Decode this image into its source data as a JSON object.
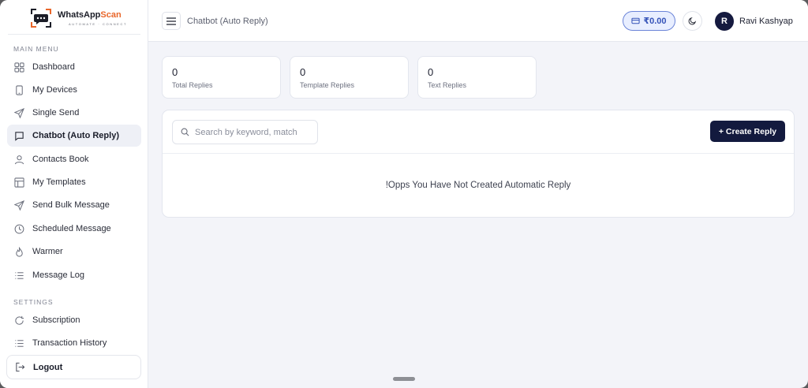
{
  "brand": {
    "name_primary": "WhatsApp",
    "name_accent": "Scan",
    "tagline": "AUTOMATE · CONNECT"
  },
  "sidebar": {
    "main_menu_label": "MAIN MENU",
    "settings_label": "SETTINGS",
    "items": [
      {
        "label": "Dashboard",
        "icon": "grid-icon"
      },
      {
        "label": "My Devices",
        "icon": "phone-icon"
      },
      {
        "label": "Single Send",
        "icon": "send-icon"
      },
      {
        "label": "Chatbot (Auto Reply)",
        "icon": "chat-icon",
        "active": true
      },
      {
        "label": "Contacts Book",
        "icon": "user-icon"
      },
      {
        "label": "My Templates",
        "icon": "layout-icon"
      },
      {
        "label": "Send Bulk Message",
        "icon": "send-icon"
      },
      {
        "label": "Scheduled Message",
        "icon": "clock-icon"
      },
      {
        "label": "Warmer",
        "icon": "flame-icon"
      },
      {
        "label": "Message Log",
        "icon": "list-icon"
      }
    ],
    "settings_items": [
      {
        "label": "Subscription",
        "icon": "refresh-icon"
      },
      {
        "label": "Transaction History",
        "icon": "list-icon"
      }
    ],
    "logout_label": "Logout"
  },
  "header": {
    "title": "Chatbot (Auto Reply)",
    "wallet_amount": "₹0.00",
    "avatar_initial": "R",
    "user_name": "Ravi Kashyap"
  },
  "stats": [
    {
      "value": "0",
      "label": "Total Replies"
    },
    {
      "value": "0",
      "label": "Template Replies"
    },
    {
      "value": "0",
      "label": "Text Replies"
    }
  ],
  "panel": {
    "search_placeholder": "Search by keyword, match",
    "create_button": "+ Create Reply",
    "empty_message": "!Opps You Have Not Created Automatic Reply"
  },
  "colors": {
    "accent": "#131a3e",
    "brand_orange": "#e8662a",
    "wallet_blue": "#3553b8"
  }
}
